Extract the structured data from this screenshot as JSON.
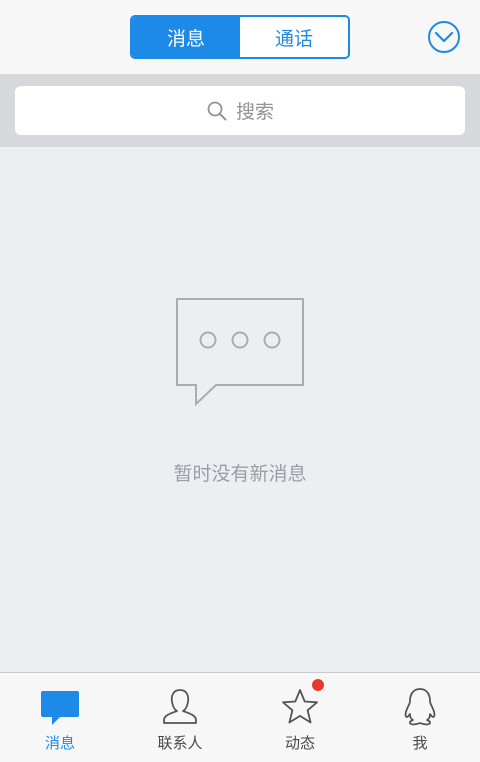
{
  "header": {
    "tabs": [
      {
        "label": "消息",
        "active": true
      },
      {
        "label": "通话",
        "active": false
      }
    ],
    "dropdown_icon": "chevron-down-circle-icon"
  },
  "search": {
    "placeholder": "搜索",
    "icon": "search-icon"
  },
  "empty_state": {
    "icon": "speech-bubble-dots-icon",
    "text": "暂时没有新消息"
  },
  "tabbar": {
    "items": [
      {
        "label": "消息",
        "icon": "chat-bubble-icon",
        "active": true
      },
      {
        "label": "联系人",
        "icon": "person-icon",
        "active": false
      },
      {
        "label": "动态",
        "icon": "star-icon",
        "active": false,
        "badge": "dot"
      },
      {
        "label": "我",
        "icon": "penguin-icon",
        "active": false
      }
    ]
  },
  "colors": {
    "accent": "#1e8ae8",
    "background": "#eceef2",
    "badge": "#e8392f",
    "muted_text": "#9a9ea4"
  }
}
